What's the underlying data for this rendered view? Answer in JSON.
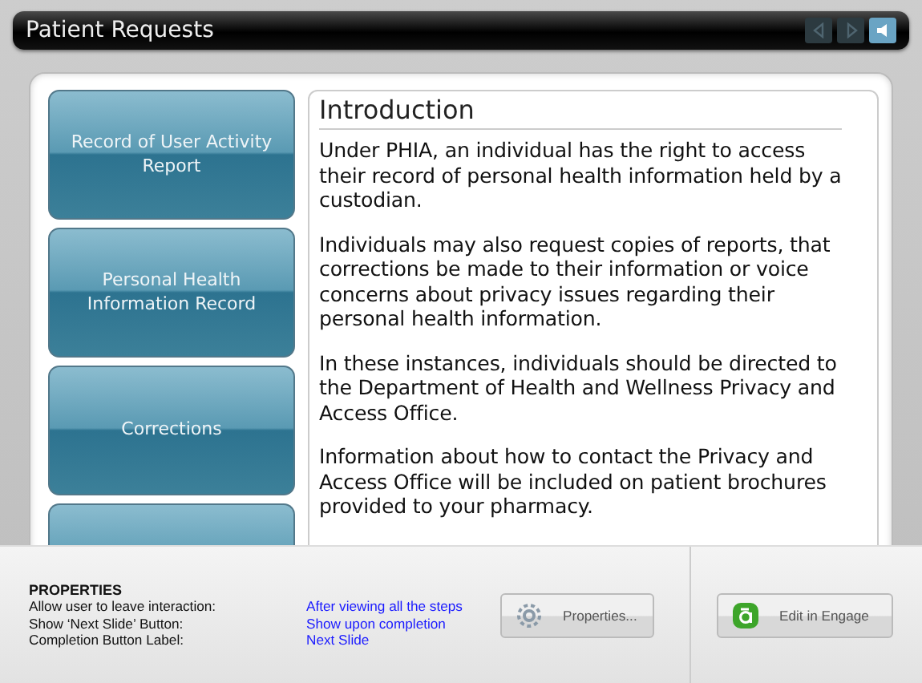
{
  "window": {
    "title": "Patient Requests"
  },
  "nav_controls": [
    {
      "kind": "back",
      "disabled": true
    },
    {
      "kind": "forward",
      "disabled": true
    },
    {
      "kind": "sound",
      "disabled": false
    }
  ],
  "side_buttons": [
    {
      "label": "Record of User Activity Report"
    },
    {
      "label": "Personal Health Information Record"
    },
    {
      "label": "Corrections"
    },
    {
      "kind": "partial"
    }
  ],
  "content": {
    "heading": "Introduction",
    "paragraphs": [
      "Under PHIA, an individual has the right to access their record of personal health information held by a custodian.",
      "Individuals may also request copies of reports, that corrections be made to their information  or voice concerns about privacy issues regarding their personal health information.",
      "In these instances, individuals should be directed to the Department of Health and Wellness Privacy and Access Office.",
      "Information about how to contact the Privacy and Access Office will be included on patient brochures provided to your pharmacy."
    ]
  },
  "properties": {
    "title": "PROPERTIES",
    "rows": [
      {
        "label": "Allow user to leave interaction:",
        "value": "After viewing all the steps"
      },
      {
        "label": "Show ‘Next Slide’ Button:",
        "value": "Show upon completion"
      },
      {
        "label": "Completion Button Label:",
        "value": "Next Slide"
      }
    ],
    "properties_button": "Properties...",
    "engage_button": "Edit in Engage"
  }
}
